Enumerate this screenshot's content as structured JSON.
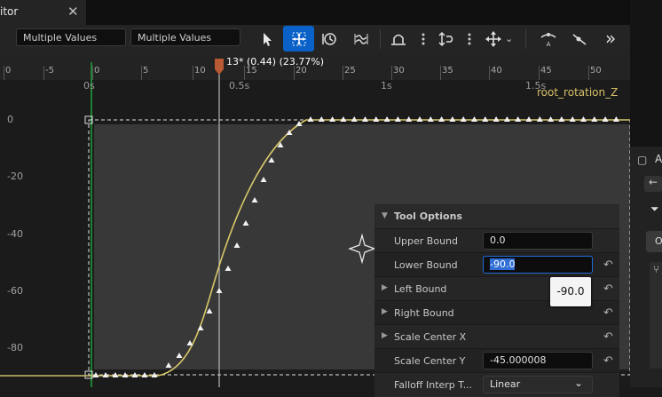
{
  "tab": {
    "title": "itor",
    "close_icon": "close-icon"
  },
  "toolbar": {
    "field1": "Multiple Values",
    "field2": "Multiple Values",
    "icons": [
      "select-arrow-icon",
      "transform-move-icon",
      "retime-icon",
      "smooth-curves-icon",
      "flatten-tangent-icon",
      "straighten-tangent-icon",
      "move-keys-icon",
      "key-reduce-icon",
      "tension-icon",
      "more-chevron-icon"
    ]
  },
  "ruler": {
    "frame_ticks": [
      "0",
      "-5",
      "0",
      "5",
      "10",
      "15",
      "20",
      "25",
      "30",
      "35",
      "40",
      "45",
      "50"
    ],
    "time_labels": [
      "0s",
      "0.5s",
      "1s",
      "1.5s"
    ],
    "playhead": "13* (0.44) (23.77%)"
  },
  "graph": {
    "y_labels": [
      "0",
      "-20",
      "-40",
      "-60",
      "-80"
    ],
    "curve_name": "root_rotation_Z"
  },
  "tool_options": {
    "header": "Tool Options",
    "rows": [
      {
        "label": "Upper Bound",
        "value": "0.0",
        "expandable": false,
        "has_reset": false
      },
      {
        "label": "Lower Bound",
        "value": "-90.0",
        "expandable": false,
        "has_reset": true
      },
      {
        "label": "Left Bound",
        "value": "",
        "expandable": true,
        "has_reset": true
      },
      {
        "label": "Right Bound",
        "value": "",
        "expandable": true,
        "has_reset": true
      },
      {
        "label": "Scale Center X",
        "value": "",
        "expandable": true,
        "has_reset": true
      },
      {
        "label": "Scale Center Y",
        "value": "-45.000008",
        "expandable": false,
        "has_reset": true
      },
      {
        "label": "Falloff Interp T...",
        "value": "Linear",
        "expandable": false,
        "has_reset": false
      }
    ]
  },
  "tooltip": "-90.0",
  "right_panel": {
    "label_a": "A",
    "label_ot": "Ot"
  },
  "colors": {
    "accent": "#0a62c8",
    "curve": "#d8c86a",
    "playhead": "#c0552e"
  }
}
